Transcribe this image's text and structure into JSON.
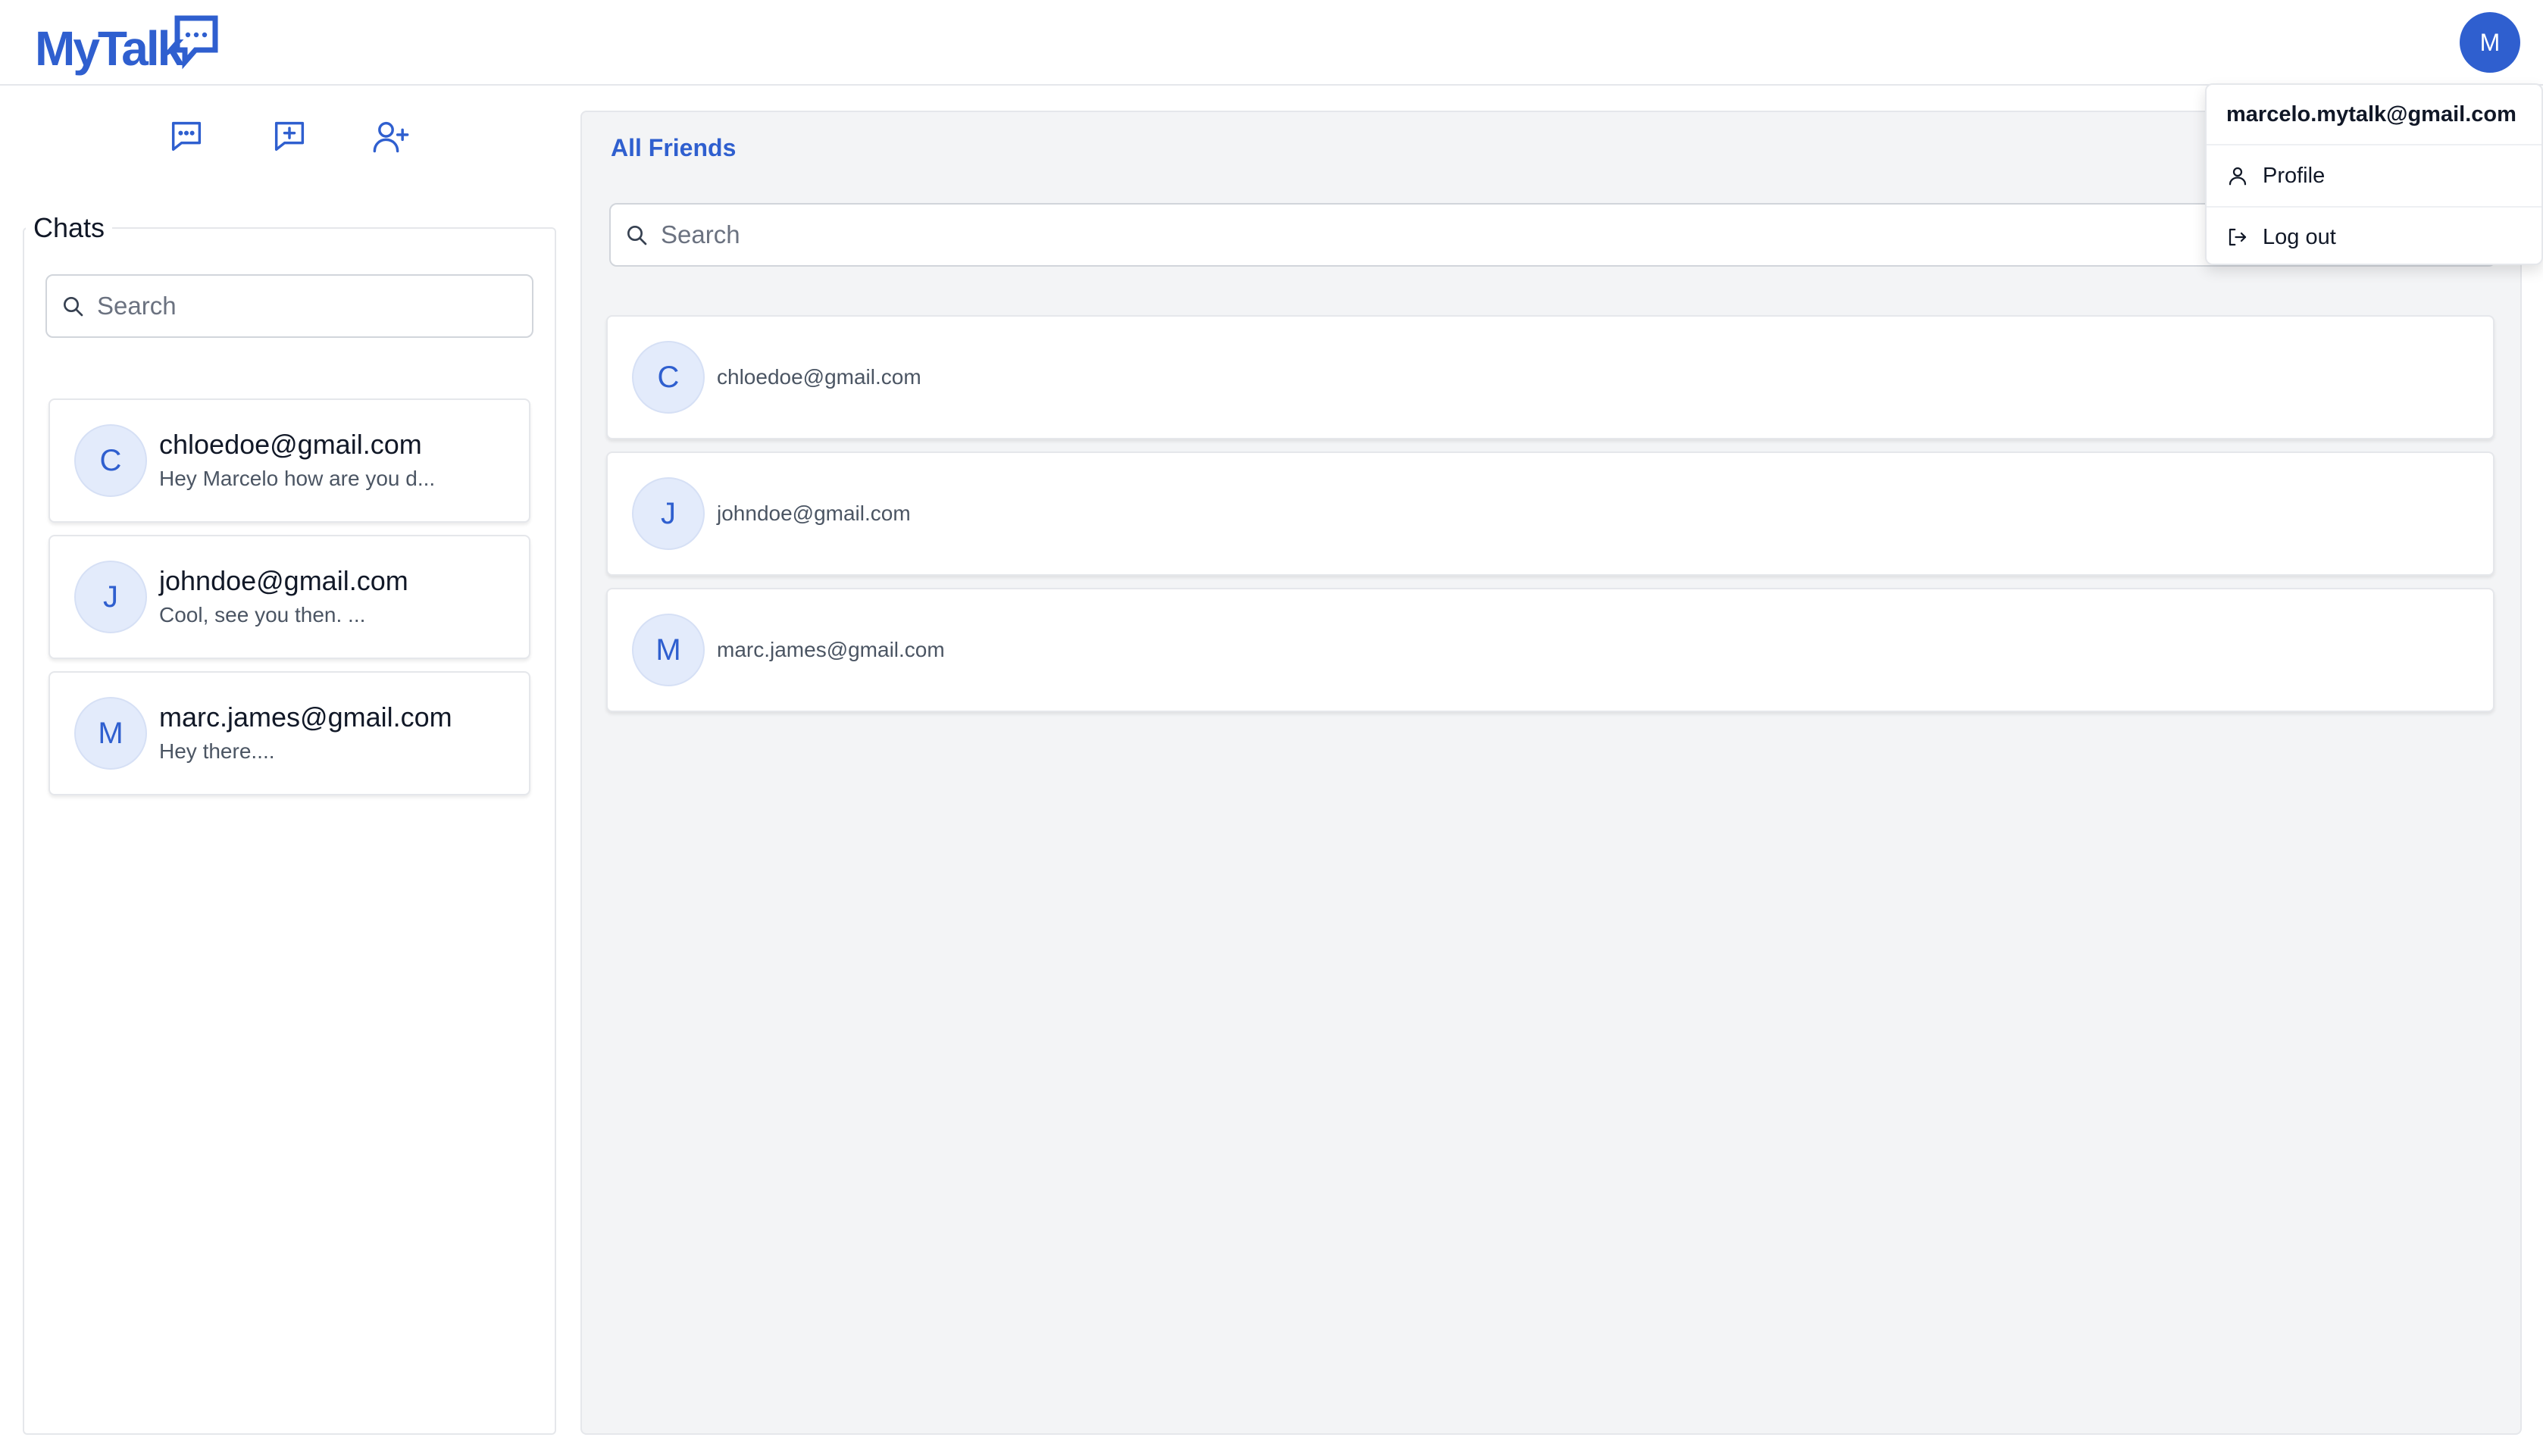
{
  "app": {
    "logo_text": "MyTalk",
    "brand_color": "#2f5fcf"
  },
  "header": {
    "user_avatar_initial": "M"
  },
  "toolbar": {
    "icons": [
      "chats-icon",
      "new-chat-icon",
      "add-friend-icon"
    ]
  },
  "chats": {
    "title": "Chats",
    "search_placeholder": "Search",
    "items": [
      {
        "initial": "C",
        "name": "chloedoe@gmail.com",
        "preview": "Hey Marcelo how are you d..."
      },
      {
        "initial": "J",
        "name": "johndoe@gmail.com",
        "preview": "Cool, see you then. ..."
      },
      {
        "initial": "M",
        "name": "marc.james@gmail.com",
        "preview": "Hey there...."
      }
    ]
  },
  "friends": {
    "title": "All Friends",
    "search_placeholder": "Search",
    "items": [
      {
        "initial": "C",
        "name": "chloedoe@gmail.com"
      },
      {
        "initial": "J",
        "name": "johndoe@gmail.com"
      },
      {
        "initial": "M",
        "name": "marc.james@gmail.com"
      }
    ]
  },
  "user_menu": {
    "email": "marcelo.mytalk@gmail.com",
    "profile_label": "Profile",
    "logout_label": "Log out"
  }
}
